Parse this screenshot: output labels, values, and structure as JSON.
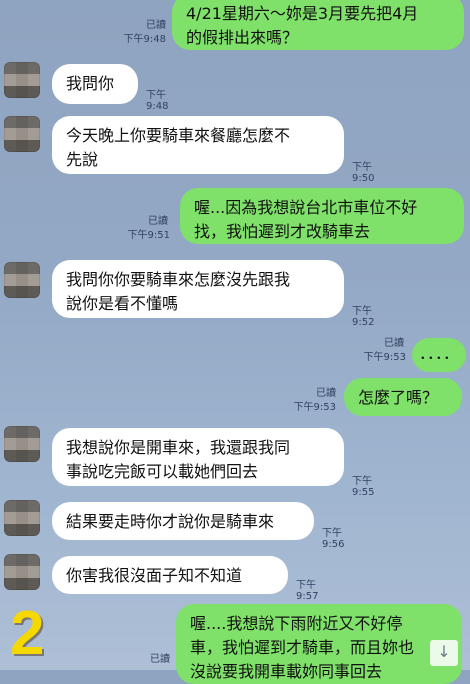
{
  "chat": {
    "m0": {
      "text": "4/21星期六～妳是3月要先把4月\n的假排出來嗎？",
      "read": "已讀",
      "time": "下午9:48"
    },
    "m1": {
      "text": "我問你",
      "time": "下午9:48"
    },
    "m2": {
      "text": "今天晚上你要騎車來餐廳怎麼不\n先說",
      "time": "下午9:50"
    },
    "m3": {
      "text": "喔...因為我想說台北市車位不好\n找，我怕遲到才改騎車去",
      "read": "已讀",
      "time": "下午9:51"
    },
    "m4": {
      "text": "我問你你要騎車來怎麼沒先跟我\n說你是看不懂嗎",
      "time": "下午9:52"
    },
    "m5": {
      "text": "．．．．",
      "read": "已讀",
      "time": "下午9:53"
    },
    "m6": {
      "text": "怎麼了嗎？",
      "read": "已讀",
      "time": "下午9:53"
    },
    "m7": {
      "text": "我想說你是開車來，我還跟我同\n事說吃完飯可以載她們回去",
      "time": "下午9:55"
    },
    "m8": {
      "text": "結果要走時你才說你是騎車來",
      "time": "下午9:56"
    },
    "m9": {
      "text": "你害我很沒面子知不知道",
      "time": "下午9:57"
    },
    "m10": {
      "text": "喔....我想說下雨附近又不好停\n車，我怕遲到才騎車，而且妳也\n沒說要我開車載妳同事回去",
      "read": "已讀"
    }
  },
  "overlay": {
    "number": "2"
  },
  "icons": {
    "scroll_down": "down-arrow-icon"
  }
}
